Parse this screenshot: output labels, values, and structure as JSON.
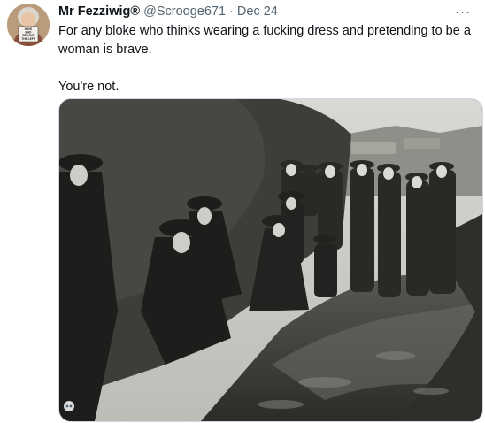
{
  "tweet": {
    "author_name": "Mr Fezziwig®",
    "handle": "@Scrooge671",
    "separator": "·",
    "date": "Dec 24",
    "more_label": "···",
    "text_paragraphs": [
      "For any bloke who thinks wearing a fucking dress and pretending to be a woman is brave.",
      "You're not."
    ]
  },
  "avatar": {
    "sign_lines": [
      "HAVE",
      "BAD",
      "BEHAVE",
      "THE LEFT"
    ]
  },
  "colors": {
    "name": "#0f1419",
    "secondary": "#536471",
    "border": "#cfd9de"
  },
  "icons": {
    "more": "more-icon",
    "media_badge": "media-alt-icon"
  }
}
